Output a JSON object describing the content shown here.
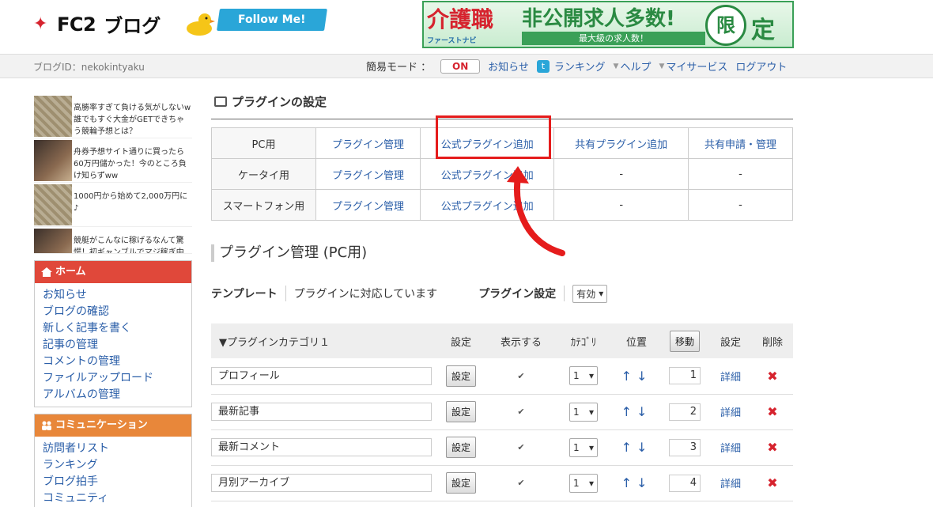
{
  "header": {
    "logo_fc2": "FC2",
    "logo_blog": "ブログ",
    "follow_label": "Follow Me!",
    "banner": {
      "left": "介護職",
      "sub": "ファーストナビ",
      "main": "非公開求人多数!",
      "bar": "最大級の求人数！",
      "circle": "限",
      "end": "定"
    }
  },
  "navbar": {
    "blog_id": "ブログID：nekokintyaku",
    "mode_label": "簡易モード ：",
    "mode_toggle": "ON",
    "links": [
      "お知らせ",
      "ランキング",
      "ヘルプ",
      "マイサービス",
      "ログアウト"
    ]
  },
  "sidebar": {
    "ads": [
      "高勝率すぎて負ける気がしないw誰でもすぐ大金がGETできちゃう競輪予想とは？",
      "舟券予想サイト通りに買ったら60万円儲かった！今のところ負け知らずww",
      "1000円から始めて2,000万円に♪",
      "競艇がこんなに稼げるなんて驚愕！初ギャンブルでマジ稼ぎ中"
    ],
    "home_title": "ホーム",
    "home_items": [
      "お知らせ",
      "ブログの確認",
      "新しく記事を書く",
      "記事の管理",
      "コメントの管理",
      "ファイルアップロード",
      "アルバムの管理"
    ],
    "comm_title": "コミュニケーション",
    "comm_items": [
      "訪問者リスト",
      "ランキング",
      "ブログ拍手",
      "コミュニティ"
    ]
  },
  "main": {
    "title": "プラグインの設定",
    "table": [
      [
        "PC用",
        "プラグイン管理",
        "公式プラグイン追加",
        "共有プラグイン追加",
        "共有申請・管理"
      ],
      [
        "ケータイ用",
        "プラグイン管理",
        "公式プラグイン追加",
        "-",
        "-"
      ],
      [
        "スマートフォン用",
        "プラグイン管理",
        "公式プラグイン追加",
        "-",
        "-"
      ]
    ],
    "sub_title": "プラグイン管理 (PC用)",
    "template_label": "テンプレート",
    "template_desc": "プラグインに対応しています",
    "plugin_setting_label": "プラグイン設定",
    "plugin_setting_value": "有効",
    "cat_headers": [
      "▼プラグインカテゴリ１",
      "設定",
      "表示する",
      "ｶﾃｺﾞﾘ",
      "位置",
      "移動",
      "設定",
      "削除"
    ],
    "rows": [
      {
        "name": "プロフィール",
        "btn": "設定",
        "cat": "1",
        "order": "1",
        "detail": "詳細"
      },
      {
        "name": "最新記事",
        "btn": "設定",
        "cat": "1",
        "order": "2",
        "detail": "詳細"
      },
      {
        "name": "最新コメント",
        "btn": "設定",
        "cat": "1",
        "order": "3",
        "detail": "詳細"
      },
      {
        "name": "月別アーカイブ",
        "btn": "設定",
        "cat": "1",
        "order": "4",
        "detail": "詳細"
      }
    ]
  },
  "colors": {
    "accent_red": "#e51c1c",
    "link": "#2a5ea8",
    "home_head": "#e0483a",
    "comm_head": "#e8873a"
  }
}
